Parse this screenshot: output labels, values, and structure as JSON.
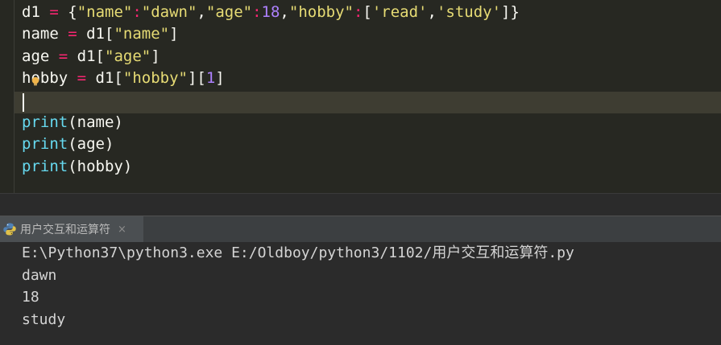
{
  "editor": {
    "lines": [
      [
        {
          "t": "d1",
          "k": "plain"
        },
        {
          "t": " ",
          "k": "plain"
        },
        {
          "t": "=",
          "k": "op"
        },
        {
          "t": " {",
          "k": "plain"
        },
        {
          "t": "\"name\"",
          "k": "str"
        },
        {
          "t": ":",
          "k": "op"
        },
        {
          "t": "\"dawn\"",
          "k": "str"
        },
        {
          "t": ",",
          "k": "plain"
        },
        {
          "t": "\"age\"",
          "k": "str"
        },
        {
          "t": ":",
          "k": "op"
        },
        {
          "t": "18",
          "k": "num"
        },
        {
          "t": ",",
          "k": "plain"
        },
        {
          "t": "\"hobby\"",
          "k": "str"
        },
        {
          "t": ":",
          "k": "op"
        },
        {
          "t": "[",
          "k": "plain"
        },
        {
          "t": "'read'",
          "k": "str"
        },
        {
          "t": ",",
          "k": "plain"
        },
        {
          "t": "'study'",
          "k": "str"
        },
        {
          "t": "]}",
          "k": "plain"
        }
      ],
      [
        {
          "t": "name",
          "k": "plain"
        },
        {
          "t": " ",
          "k": "plain"
        },
        {
          "t": "=",
          "k": "op"
        },
        {
          "t": " d1[",
          "k": "plain"
        },
        {
          "t": "\"name\"",
          "k": "str"
        },
        {
          "t": "]",
          "k": "plain"
        }
      ],
      [
        {
          "t": "age",
          "k": "plain"
        },
        {
          "t": " ",
          "k": "plain"
        },
        {
          "t": "=",
          "k": "op"
        },
        {
          "t": " d1[",
          "k": "plain"
        },
        {
          "t": "\"age\"",
          "k": "str"
        },
        {
          "t": "]",
          "k": "plain"
        }
      ],
      [
        {
          "t": "hobby",
          "k": "plain"
        },
        {
          "t": " ",
          "k": "plain"
        },
        {
          "t": "=",
          "k": "op"
        },
        {
          "t": " d1[",
          "k": "plain"
        },
        {
          "t": "\"hobby\"",
          "k": "str"
        },
        {
          "t": "][",
          "k": "plain"
        },
        {
          "t": "1",
          "k": "num"
        },
        {
          "t": "]",
          "k": "plain"
        }
      ],
      [],
      [
        {
          "t": "print",
          "k": "fn"
        },
        {
          "t": "(name)",
          "k": "plain"
        }
      ],
      [
        {
          "t": "print",
          "k": "fn"
        },
        {
          "t": "(age)",
          "k": "plain"
        }
      ],
      [
        {
          "t": "print",
          "k": "fn"
        },
        {
          "t": "(hobby)",
          "k": "plain"
        }
      ]
    ]
  },
  "run_panel": {
    "tab_label": "用户交互和运算符",
    "close_symbol": "×",
    "tab_icon": "python-icon",
    "console_lines": [
      "E:\\Python37\\python3.exe E:/Oldboy/python3/1102/用户交互和运算符.py",
      "dawn",
      "18",
      "study"
    ]
  },
  "colors": {
    "editor_bg": "#272822",
    "current_line_bg": "#3e3d32",
    "operator": "#f92672",
    "string": "#e6db74",
    "number": "#ae81ff",
    "function": "#66d9ef",
    "text": "#f8f8f2",
    "console_bg": "#2b2b2b",
    "console_text": "#d4d4d4"
  }
}
